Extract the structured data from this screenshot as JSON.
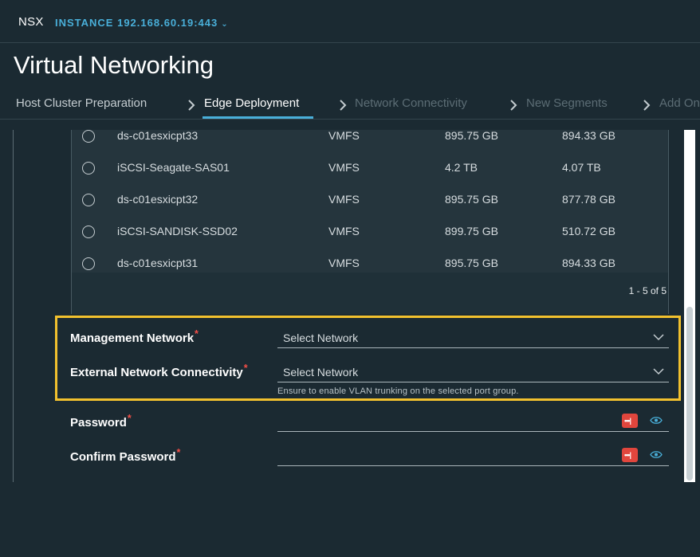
{
  "topbar": {
    "brand": "NSX",
    "instance": "INSTANCE 192.168.60.19:443"
  },
  "page": {
    "title": "Virtual Networking"
  },
  "tabs": [
    {
      "label": "Host Cluster Preparation",
      "state": "done"
    },
    {
      "label": "Edge Deployment",
      "state": "active"
    },
    {
      "label": "Network Connectivity",
      "state": "disabled"
    },
    {
      "label": "New Segments",
      "state": "disabled"
    },
    {
      "label": "Add On",
      "state": "disabled"
    }
  ],
  "datastores": [
    {
      "name": "ds-c01esxicpt33",
      "type": "VMFS",
      "capacity": "895.75 GB",
      "free": "894.33 GB"
    },
    {
      "name": "iSCSI-Seagate-SAS01",
      "type": "VMFS",
      "capacity": "4.2 TB",
      "free": "4.07 TB"
    },
    {
      "name": "ds-c01esxicpt32",
      "type": "VMFS",
      "capacity": "895.75 GB",
      "free": "877.78 GB"
    },
    {
      "name": "iSCSI-SANDISK-SSD02",
      "type": "VMFS",
      "capacity": "899.75 GB",
      "free": "510.72 GB"
    },
    {
      "name": "ds-c01esxicpt31",
      "type": "VMFS",
      "capacity": "895.75 GB",
      "free": "894.33 GB"
    }
  ],
  "pagination": "1 - 5 of 5",
  "form": {
    "management_network": {
      "label": "Management Network",
      "placeholder": "Select Network"
    },
    "external_network": {
      "label": "External Network Connectivity",
      "placeholder": "Select Network",
      "helper": "Ensure to enable VLAN trunking on the selected port group."
    },
    "password": {
      "label": "Password"
    },
    "confirm_password": {
      "label": "Confirm Password"
    },
    "required_marker": "*"
  },
  "colors": {
    "accent": "#49afd9",
    "highlight": "#f2c12e",
    "required": "#f54f47",
    "password_generate": "#e1463d"
  }
}
